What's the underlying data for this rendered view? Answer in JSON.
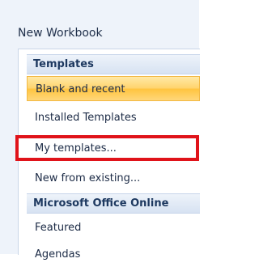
{
  "window": {
    "title": "New Workbook"
  },
  "sidebar": {
    "sections": [
      {
        "label": "Templates"
      },
      {
        "label": "Microsoft Office Online"
      }
    ],
    "items": [
      {
        "label": "Blank and recent"
      },
      {
        "label": "Installed Templates"
      },
      {
        "label": "My templates..."
      },
      {
        "label": "New from existing..."
      },
      {
        "label": "Featured"
      },
      {
        "label": "Agendas"
      }
    ],
    "selected_item": "Blank and recent",
    "highlighted_item": "My templates..."
  },
  "colors": {
    "selected_bg": "#ffd46e",
    "highlight_border": "#e0131a",
    "section_text": "#1e3960"
  }
}
